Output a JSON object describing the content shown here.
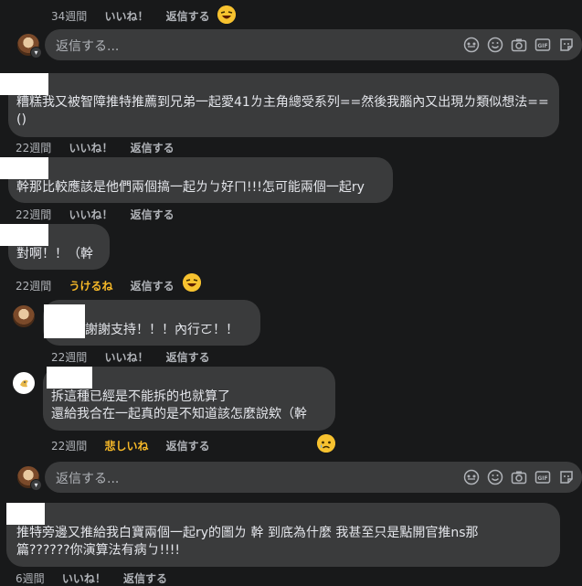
{
  "actions": {
    "like": "いいね！",
    "reply": "返信する",
    "haha": "うけるね",
    "sad": "悲しいね"
  },
  "reply_box": {
    "placeholder": "返信する..."
  },
  "comments": [
    {
      "time": "34週間"
    },
    {
      "time": "22週間",
      "text": "糟糕我又被智障推特推薦到兄弟一起愛41ㄌ主角總受系列==然後我腦內又出現ㄌ類似想法==()"
    },
    {
      "time": "22週間",
      "text": "幹那比較應該是他們兩個搞一起ㄌㄅ好ㄇ!!!怎可能兩個一起ry"
    },
    {
      "time": "22週間",
      "text": "對啊！！（幹"
    },
    {
      "time": "22週間",
      "text": "謝謝支持！！！內行ㄛ！！"
    },
    {
      "time": "22週間",
      "lines": [
        "拆這種已經是不能拆的也就算了",
        "還給我合在一起真的是不知道該怎麼說欸（幹"
      ]
    },
    {
      "lines": [
        "推特旁邊又推給我白寶兩個一起ry的圖ㄌ 幹 到底為什麼 我甚至只是點開官推ns那",
        "篇??????你演算法有病ㄅ!!!!"
      ]
    },
    {
      "time": "6週間"
    }
  ],
  "icons": [
    "emoji-icon",
    "smile-icon",
    "camera-icon",
    "gif-icon",
    "sticker-icon"
  ],
  "colors": {
    "bg": "#18191a",
    "bubble": "#3a3b3c",
    "reaction_yellow": "#f7b928"
  }
}
